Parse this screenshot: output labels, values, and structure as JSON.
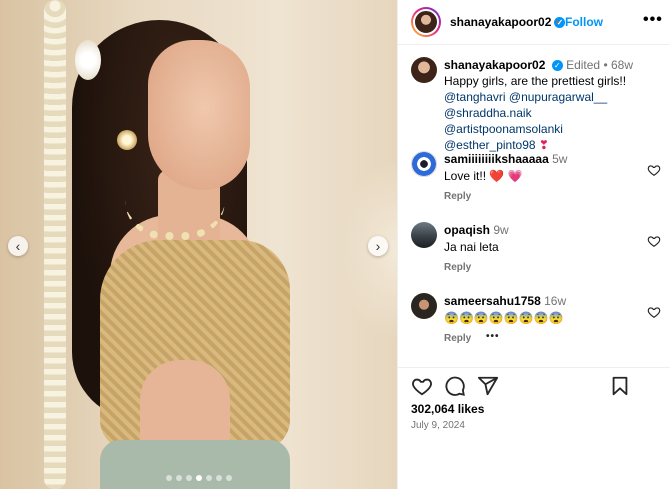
{
  "post": {
    "image_nav": {
      "prev_symbol": "‹",
      "next_symbol": "›",
      "slide_count": 7,
      "active_slide": 3
    },
    "header": {
      "username": "shanayakapoor02",
      "verified": true,
      "separator": "•",
      "follow_label": "Follow",
      "more_label": "•••"
    },
    "caption": {
      "username": "shanayakapoor02",
      "edited": "Edited",
      "separator": "•",
      "age": "68w",
      "text": "Happy girls, are the prettiest girls!!",
      "mentions": [
        "@tanghavri",
        "@nupuragarwal__",
        "@shraddha.naik",
        "@artistpoonamsolanki",
        "@esther_pinto98"
      ],
      "trailing_emoji": "❣"
    },
    "comments": [
      {
        "username": "samiiiiiiiikshaaaaa",
        "age": "5w",
        "text": "Love it!! ❤️ 💗",
        "reply_label": "Reply"
      },
      {
        "username": "opaqish",
        "age": "9w",
        "text": "Ja nai leta",
        "reply_label": "Reply"
      },
      {
        "username": "sameersahu1758",
        "age": "16w",
        "text": "😨😨😨😨😨😨😨😨",
        "reply_label": "Reply",
        "more_label": "•••"
      }
    ],
    "likes": "302,064 likes",
    "date": "July 9, 2024",
    "colors": {
      "link": "#0095f6",
      "mention": "#00376b",
      "muted": "#737373",
      "heart": "#e0245e"
    }
  }
}
